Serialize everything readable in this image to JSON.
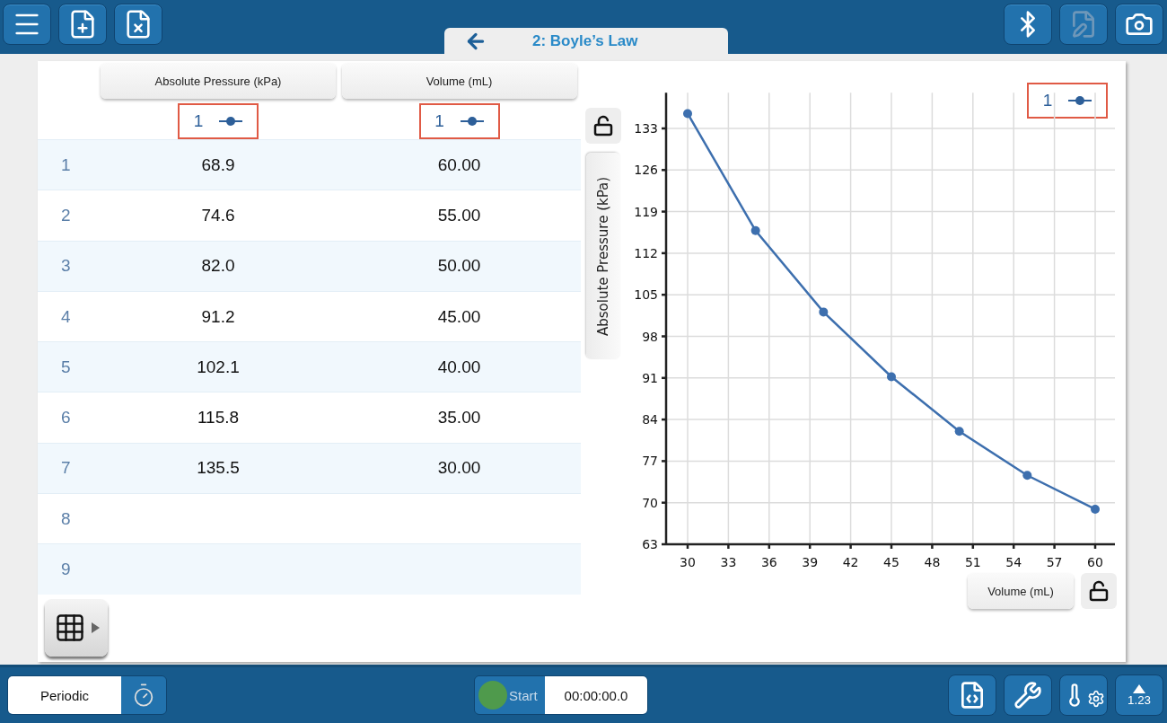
{
  "top_bar": {
    "left_buttons": [
      {
        "kind": "menu",
        "disabled": false
      },
      {
        "kind": "new-file",
        "disabled": false
      },
      {
        "kind": "close-file",
        "disabled": false
      }
    ],
    "tab": {
      "title": "2: Boyle’s Law"
    },
    "right_buttons": [
      {
        "kind": "bluetooth",
        "disabled": false
      },
      {
        "kind": "annotate",
        "disabled": true
      },
      {
        "kind": "camera",
        "disabled": false
      }
    ]
  },
  "table": {
    "columns": [
      {
        "header": "Absolute Pressure (kPa)",
        "marker_label": "1"
      },
      {
        "header": "Volume (mL)",
        "marker_label": "1"
      }
    ],
    "rows": [
      {
        "index": "1",
        "cells": [
          "68.9",
          "60.00"
        ]
      },
      {
        "index": "2",
        "cells": [
          "74.6",
          "55.00"
        ]
      },
      {
        "index": "3",
        "cells": [
          "82.0",
          "50.00"
        ]
      },
      {
        "index": "4",
        "cells": [
          "91.2",
          "45.00"
        ]
      },
      {
        "index": "5",
        "cells": [
          "102.1",
          "40.00"
        ]
      },
      {
        "index": "6",
        "cells": [
          "115.8",
          "35.00"
        ]
      },
      {
        "index": "7",
        "cells": [
          "135.5",
          "30.00"
        ]
      },
      {
        "index": "8"
      },
      {
        "index": "9"
      }
    ]
  },
  "chart": {
    "y_locked": false,
    "x_locked": false,
    "chart_data": {
      "type": "line",
      "xlabel": "Volume (mL)",
      "ylabel": "Absolute Pressure (kPa)",
      "x": [
        60,
        55,
        50,
        45,
        40,
        35,
        30
      ],
      "grid": true,
      "series": [
        {
          "name": "1",
          "color": "#3d6fae",
          "marker": "circle",
          "values": [
            68.9,
            74.6,
            82.0,
            91.2,
            102.1,
            115.8,
            135.5
          ]
        }
      ],
      "xlim": [
        30,
        60
      ],
      "ylim": [
        63,
        139
      ],
      "xticks": [
        30,
        33,
        36,
        39,
        42,
        45,
        48,
        51,
        54,
        57,
        60
      ],
      "yticks": [
        63,
        70,
        77,
        84,
        91,
        98,
        105,
        112,
        119,
        126,
        133
      ]
    }
  },
  "bottom_bar": {
    "mode": "Periodic",
    "start_label": "Start",
    "time": "00:00:00.0",
    "tools": [
      {
        "kind": "code-book"
      },
      {
        "kind": "tools"
      },
      {
        "kind": "sensor-settings"
      },
      {
        "kind": "meter",
        "label": "1.23"
      }
    ]
  }
}
